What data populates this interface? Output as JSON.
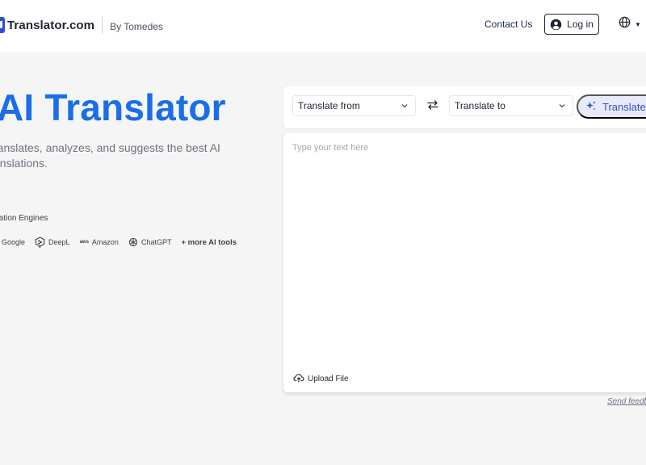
{
  "header": {
    "logo_text": "Translator.com",
    "logo_by": "By Tomedes",
    "contact_label": "Contact Us",
    "login_label": "Log in",
    "icons": {
      "login": "user-circle-icon",
      "language": "globe-icon",
      "caret": "caret-down-icon"
    }
  },
  "hero": {
    "title": "AI Translator",
    "description": "ranslates, analyzes, and suggests the best AI anslations.",
    "engines_label": "nslation Engines",
    "engines": [
      "Google",
      "DeepL",
      "Amazon",
      "ChatGPT"
    ],
    "amazon_mark": "aws",
    "more_tools": "+ more AI tools"
  },
  "translator": {
    "from_label": "Translate from",
    "to_label": "Translate to",
    "translate_label": "Translate",
    "placeholder": "Type your text here",
    "upload_label": "Upload File",
    "feedback_label": "Send feedb"
  },
  "colors": {
    "brand_blue": "#1a6ee8",
    "accent": "#2b4fd1",
    "page_bg": "#f5f5f5",
    "translate_btn_bg": "#e8ebf7"
  }
}
